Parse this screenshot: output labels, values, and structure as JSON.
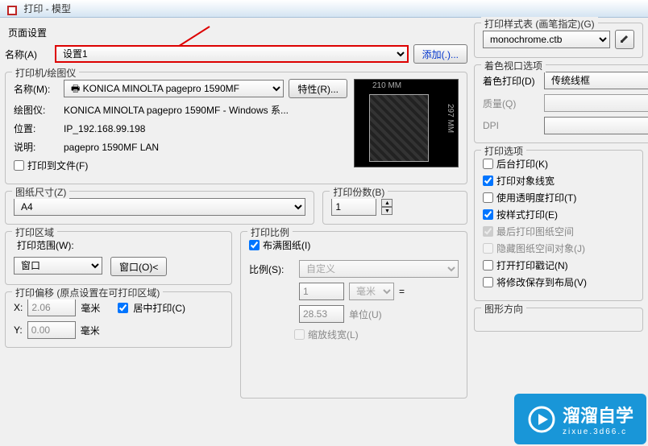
{
  "title": "打印 - 模型",
  "page_settings": {
    "legend": "页面设置",
    "name_label": "名称(A)",
    "name_value": "设置1",
    "add_button": "添加(.)..."
  },
  "printer": {
    "legend": "打印机/绘图仪",
    "name_label": "名称(M):",
    "name_value": "KONICA MINOLTA pagepro 1590MF",
    "properties_button": "特性(R)...",
    "plotter_label": "绘图仪:",
    "plotter_value": "KONICA MINOLTA pagepro 1590MF - Windows 系...",
    "location_label": "位置:",
    "location_value": "IP_192.168.99.198",
    "desc_label": "说明:",
    "desc_value": "pagepro 1590MF LAN",
    "print_to_file": "打印到文件(F)",
    "preview_w": "210  MM",
    "preview_h": "297  MM"
  },
  "paper": {
    "legend": "图纸尺寸(Z)",
    "value": "A4"
  },
  "copies": {
    "legend": "打印份数(B)",
    "value": "1"
  },
  "area": {
    "legend": "打印区域",
    "range_label": "打印范围(W):",
    "range_value": "窗口",
    "window_button": "窗口(O)<"
  },
  "offset": {
    "legend": "打印偏移 (原点设置在可打印区域)",
    "x_label": "X:",
    "x_value": "2.06",
    "x_unit": "毫米",
    "y_label": "Y:",
    "y_value": "0.00",
    "y_unit": "毫米",
    "center": "居中打印(C)"
  },
  "scale": {
    "legend": "打印比例",
    "fit": "布满图纸(I)",
    "ratio_label": "比例(S):",
    "ratio_value": "自定义",
    "num_value": "1",
    "num_unit": "毫米",
    "den_value": "28.53",
    "den_unit": "单位(U)",
    "eq": "=",
    "scale_lw": "缩放线宽(L)"
  },
  "style": {
    "legend": "打印样式表 (画笔指定)(G)",
    "value": "monochrome.ctb"
  },
  "viewport": {
    "legend": "着色视口选项",
    "shade_label": "着色打印(D)",
    "shade_value": "传统线框",
    "quality_label": "质量(Q)",
    "dpi_label": "DPI"
  },
  "options": {
    "legend": "打印选项",
    "bg": "后台打印(K)",
    "lw": "打印对象线宽",
    "trans": "使用透明度打印(T)",
    "style": "按样式打印(E)",
    "last": "最后打印图纸空间",
    "hide": "隐藏图纸空间对象(J)",
    "stamp": "打开打印戳记(N)",
    "save": "将修改保存到布局(V)"
  },
  "orientation": {
    "legend": "图形方向"
  },
  "watermark": {
    "text": "溜溜自学",
    "sub": "zixue.3d66.c"
  }
}
